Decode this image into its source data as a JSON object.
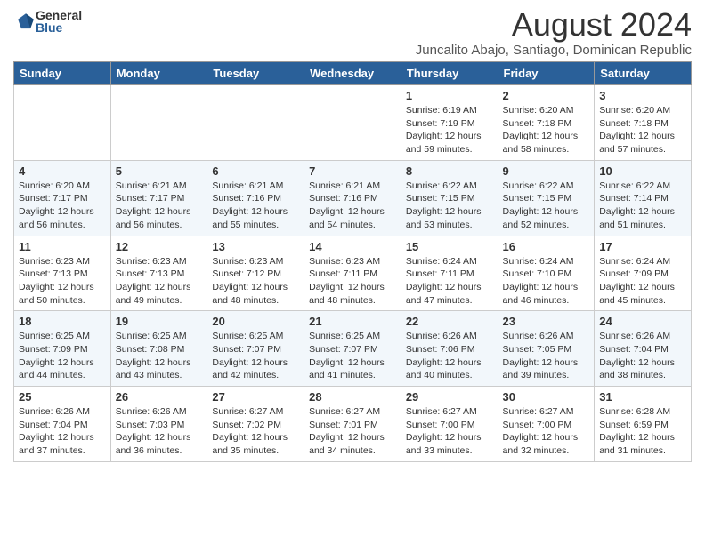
{
  "header": {
    "logo_general": "General",
    "logo_blue": "Blue",
    "month_year": "August 2024",
    "location": "Juncalito Abajo, Santiago, Dominican Republic"
  },
  "weekdays": [
    "Sunday",
    "Monday",
    "Tuesday",
    "Wednesday",
    "Thursday",
    "Friday",
    "Saturday"
  ],
  "weeks": [
    [
      {
        "day": "",
        "info": ""
      },
      {
        "day": "",
        "info": ""
      },
      {
        "day": "",
        "info": ""
      },
      {
        "day": "",
        "info": ""
      },
      {
        "day": "1",
        "info": "Sunrise: 6:19 AM\nSunset: 7:19 PM\nDaylight: 12 hours\nand 59 minutes."
      },
      {
        "day": "2",
        "info": "Sunrise: 6:20 AM\nSunset: 7:18 PM\nDaylight: 12 hours\nand 58 minutes."
      },
      {
        "day": "3",
        "info": "Sunrise: 6:20 AM\nSunset: 7:18 PM\nDaylight: 12 hours\nand 57 minutes."
      }
    ],
    [
      {
        "day": "4",
        "info": "Sunrise: 6:20 AM\nSunset: 7:17 PM\nDaylight: 12 hours\nand 56 minutes."
      },
      {
        "day": "5",
        "info": "Sunrise: 6:21 AM\nSunset: 7:17 PM\nDaylight: 12 hours\nand 56 minutes."
      },
      {
        "day": "6",
        "info": "Sunrise: 6:21 AM\nSunset: 7:16 PM\nDaylight: 12 hours\nand 55 minutes."
      },
      {
        "day": "7",
        "info": "Sunrise: 6:21 AM\nSunset: 7:16 PM\nDaylight: 12 hours\nand 54 minutes."
      },
      {
        "day": "8",
        "info": "Sunrise: 6:22 AM\nSunset: 7:15 PM\nDaylight: 12 hours\nand 53 minutes."
      },
      {
        "day": "9",
        "info": "Sunrise: 6:22 AM\nSunset: 7:15 PM\nDaylight: 12 hours\nand 52 minutes."
      },
      {
        "day": "10",
        "info": "Sunrise: 6:22 AM\nSunset: 7:14 PM\nDaylight: 12 hours\nand 51 minutes."
      }
    ],
    [
      {
        "day": "11",
        "info": "Sunrise: 6:23 AM\nSunset: 7:13 PM\nDaylight: 12 hours\nand 50 minutes."
      },
      {
        "day": "12",
        "info": "Sunrise: 6:23 AM\nSunset: 7:13 PM\nDaylight: 12 hours\nand 49 minutes."
      },
      {
        "day": "13",
        "info": "Sunrise: 6:23 AM\nSunset: 7:12 PM\nDaylight: 12 hours\nand 48 minutes."
      },
      {
        "day": "14",
        "info": "Sunrise: 6:23 AM\nSunset: 7:11 PM\nDaylight: 12 hours\nand 48 minutes."
      },
      {
        "day": "15",
        "info": "Sunrise: 6:24 AM\nSunset: 7:11 PM\nDaylight: 12 hours\nand 47 minutes."
      },
      {
        "day": "16",
        "info": "Sunrise: 6:24 AM\nSunset: 7:10 PM\nDaylight: 12 hours\nand 46 minutes."
      },
      {
        "day": "17",
        "info": "Sunrise: 6:24 AM\nSunset: 7:09 PM\nDaylight: 12 hours\nand 45 minutes."
      }
    ],
    [
      {
        "day": "18",
        "info": "Sunrise: 6:25 AM\nSunset: 7:09 PM\nDaylight: 12 hours\nand 44 minutes."
      },
      {
        "day": "19",
        "info": "Sunrise: 6:25 AM\nSunset: 7:08 PM\nDaylight: 12 hours\nand 43 minutes."
      },
      {
        "day": "20",
        "info": "Sunrise: 6:25 AM\nSunset: 7:07 PM\nDaylight: 12 hours\nand 42 minutes."
      },
      {
        "day": "21",
        "info": "Sunrise: 6:25 AM\nSunset: 7:07 PM\nDaylight: 12 hours\nand 41 minutes."
      },
      {
        "day": "22",
        "info": "Sunrise: 6:26 AM\nSunset: 7:06 PM\nDaylight: 12 hours\nand 40 minutes."
      },
      {
        "day": "23",
        "info": "Sunrise: 6:26 AM\nSunset: 7:05 PM\nDaylight: 12 hours\nand 39 minutes."
      },
      {
        "day": "24",
        "info": "Sunrise: 6:26 AM\nSunset: 7:04 PM\nDaylight: 12 hours\nand 38 minutes."
      }
    ],
    [
      {
        "day": "25",
        "info": "Sunrise: 6:26 AM\nSunset: 7:04 PM\nDaylight: 12 hours\nand 37 minutes."
      },
      {
        "day": "26",
        "info": "Sunrise: 6:26 AM\nSunset: 7:03 PM\nDaylight: 12 hours\nand 36 minutes."
      },
      {
        "day": "27",
        "info": "Sunrise: 6:27 AM\nSunset: 7:02 PM\nDaylight: 12 hours\nand 35 minutes."
      },
      {
        "day": "28",
        "info": "Sunrise: 6:27 AM\nSunset: 7:01 PM\nDaylight: 12 hours\nand 34 minutes."
      },
      {
        "day": "29",
        "info": "Sunrise: 6:27 AM\nSunset: 7:00 PM\nDaylight: 12 hours\nand 33 minutes."
      },
      {
        "day": "30",
        "info": "Sunrise: 6:27 AM\nSunset: 7:00 PM\nDaylight: 12 hours\nand 32 minutes."
      },
      {
        "day": "31",
        "info": "Sunrise: 6:28 AM\nSunset: 6:59 PM\nDaylight: 12 hours\nand 31 minutes."
      }
    ]
  ]
}
